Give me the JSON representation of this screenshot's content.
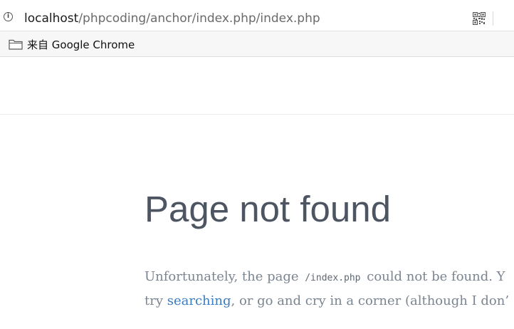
{
  "browser": {
    "url_host": "localhost",
    "url_path": "/phpcoding/anchor/index.php/index.php",
    "info_icon": "i",
    "bookmarks": [
      {
        "label": "来自 Google Chrome",
        "icon": "folder-icon"
      }
    ]
  },
  "page": {
    "title": "Page not found",
    "message": {
      "line1_before": "Unfortunately, the page ",
      "path": "/index.php",
      "line1_after": " could not be found. Y",
      "line2_before": "try ",
      "link_label": "searching",
      "line2_after": ", or go and cry in a corner (although I don’"
    }
  },
  "colors": {
    "title": "#4c5561",
    "body_text": "#7b8591",
    "link": "#3b7bbf"
  }
}
